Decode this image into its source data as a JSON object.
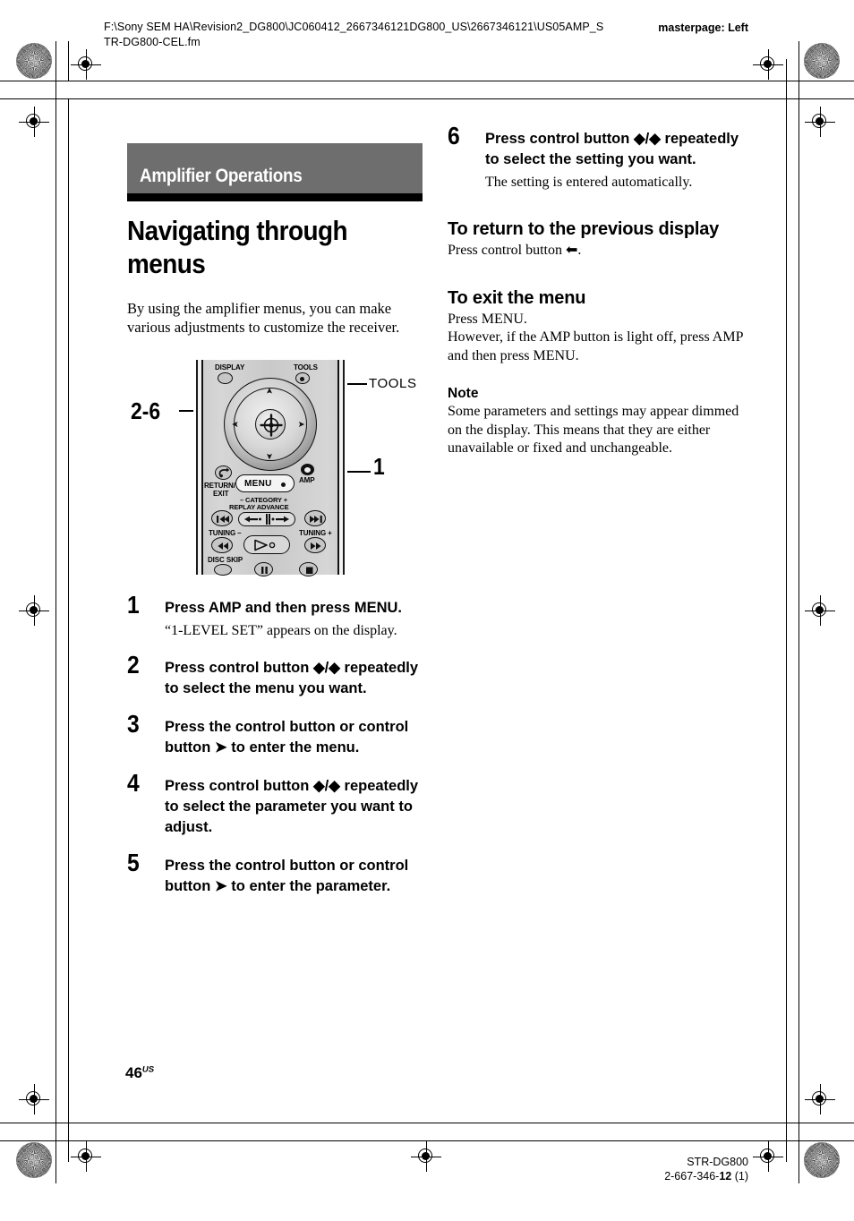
{
  "header": {
    "file_path": "F:\\Sony SEM HA\\Revision2_DG800\\JC060412_2667346121DG800_US\\2667346121\\US05AMP_STR-DG800-CEL.fm",
    "masterpage": "masterpage: Left"
  },
  "section": {
    "band_label": "Amplifier Operations",
    "title": "Navigating through menus",
    "intro": "By using the amplifier menus, you can make various adjustments to customize the receiver."
  },
  "figure": {
    "callout_left": "2-6",
    "callout_right": "1",
    "callout_tools": "TOOLS",
    "buttons": {
      "display": "DISPLAY",
      "tools": "TOOLS",
      "return_exit_line1": "RETURN/",
      "return_exit_line2": "EXIT",
      "menu": "MENU",
      "amp": "AMP",
      "category": "– CATEGORY +",
      "replay_advance": "REPLAY ADVANCE",
      "tuning_minus": "TUNING –",
      "tuning_plus": "TUNING +",
      "disc_skip": "DISC SKIP"
    }
  },
  "steps": [
    {
      "number": "1",
      "text": "Press AMP and then press MENU.",
      "sub": "“1-LEVEL SET” appears on the display."
    },
    {
      "number": "2",
      "text": "Press control button ♦/♦ repeatedly to select the menu you want.",
      "text_pre": "Press control button ",
      "text_post": " repeatedly to select the menu you want.",
      "arrows": "updown",
      "sub": ""
    },
    {
      "number": "3",
      "text_pre": "Press the control button or control button ",
      "text_post": " to enter the menu.",
      "arrows": "right",
      "sub": ""
    },
    {
      "number": "4",
      "text_pre": "Press control button ",
      "text_post": " repeatedly to select the parameter you want to adjust.",
      "arrows": "updown",
      "sub": ""
    },
    {
      "number": "5",
      "text_pre": "Press the control button or control button ",
      "text_post": " to enter the parameter.",
      "arrows": "right",
      "sub": ""
    },
    {
      "number": "6",
      "text_pre": "Press control button ",
      "text_post": " repeatedly to select the setting you want.",
      "arrows": "updown",
      "sub": "The setting is entered automatically."
    }
  ],
  "right_column": {
    "return_heading": "To return to the previous display",
    "return_body_pre": "Press control button ",
    "return_body_post": ".",
    "exit_heading": "To exit the menu",
    "exit_body_line1": "Press MENU.",
    "exit_body_line2": "However, if the AMP button is light off, press AMP and then press MENU.",
    "note_heading": "Note",
    "note_body": "Some parameters and settings may appear dimmed on the display. This means that they are either unavailable or fixed and unchangeable."
  },
  "footer": {
    "page_number": "46",
    "page_suffix": "US",
    "model": "STR-DG800",
    "part_number_pre": "2-667-346-",
    "part_number_bold": "12",
    "part_number_post": " (1)"
  },
  "colors": {
    "band_gray": "#6e6e6e",
    "rule_black": "#000000",
    "remote_body": "#cfcfcf"
  }
}
